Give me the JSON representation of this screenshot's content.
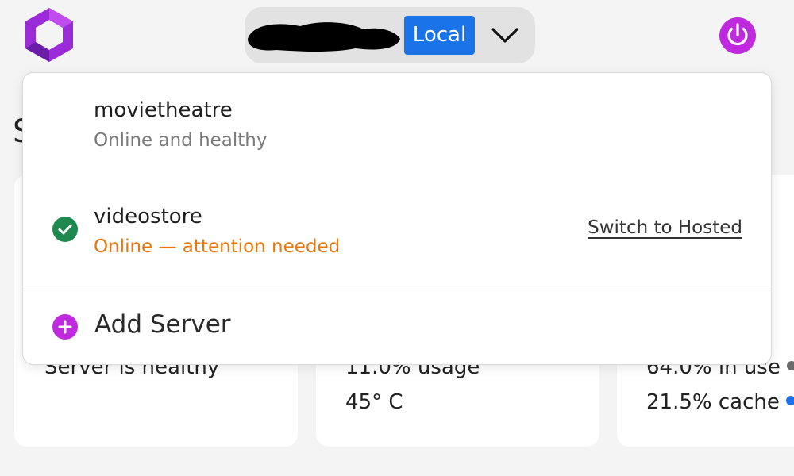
{
  "header": {
    "logo_icon": "hexagon-logo-icon",
    "server_switcher": {
      "environment_badge": "Local",
      "chevron_icon": "chevron-down-icon"
    },
    "power_icon": "power-icon"
  },
  "page": {
    "heading": "S",
    "cards": [
      {
        "line1": "Server is healthy",
        "line2": ""
      },
      {
        "line1": "11.0% usage",
        "line2": "45° C"
      },
      {
        "line1": "64.0% in use",
        "line2": "21.5% cache",
        "legend_colors": [
          "#6b6b6b",
          "#1a73e8"
        ]
      }
    ]
  },
  "dropdown": {
    "servers": [
      {
        "name": "movietheatre",
        "status": "Online and healthy",
        "status_color": "#7a7a7a",
        "selected": false
      },
      {
        "name": "videostore",
        "status": "Online — attention needed",
        "status_color": "#e8770e",
        "selected": true,
        "action": "Switch to Hosted"
      }
    ],
    "add_server_label": "Add Server"
  },
  "colors": {
    "brand_purple": "#c02adf",
    "accent_blue": "#1a73e8",
    "success_green": "#1f8a50",
    "warning_orange": "#e8770e"
  }
}
